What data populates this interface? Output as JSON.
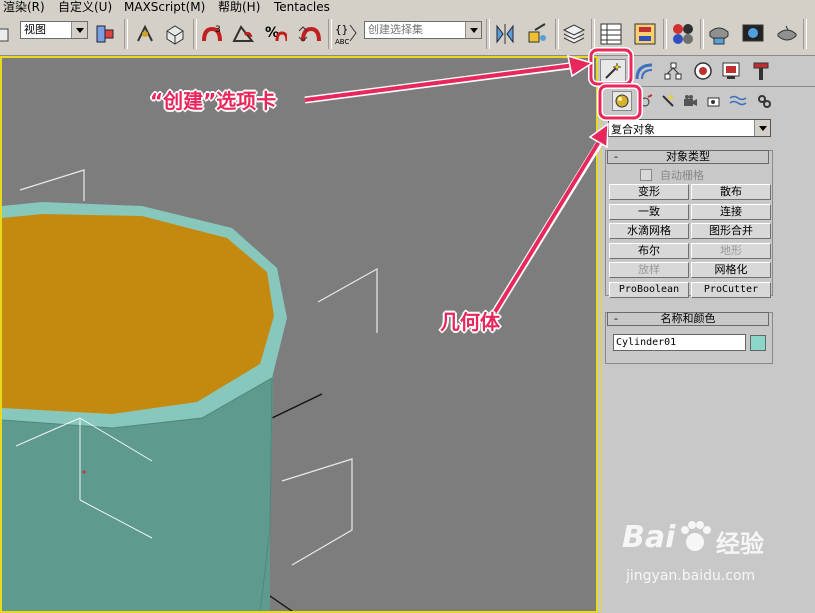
{
  "menu": {
    "items": [
      "渲染(R)",
      "自定义(U)",
      "MAXScript(M)",
      "帮助(H)",
      "Tentacles"
    ]
  },
  "toolbar": {
    "view_combo": "视图",
    "selection_set_placeholder": "创建选择集",
    "abc_label": "ABC"
  },
  "command_panel": {
    "tabs": [
      "create-tab",
      "modify-tab",
      "hierarchy-tab",
      "motion-tab",
      "display-tab",
      "utilities-tab"
    ],
    "category_dropdown": "复合对象",
    "object_type_rollout": {
      "title": "对象类型",
      "collapse_glyph": "-",
      "autogrid_label": "自动栅格",
      "buttons": [
        {
          "label": "变形",
          "enabled": true
        },
        {
          "label": "散布",
          "enabled": true
        },
        {
          "label": "一致",
          "enabled": true
        },
        {
          "label": "连接",
          "enabled": true
        },
        {
          "label": "水滴网格",
          "enabled": true
        },
        {
          "label": "图形合并",
          "enabled": true
        },
        {
          "label": "布尔",
          "enabled": true
        },
        {
          "label": "地形",
          "enabled": false
        },
        {
          "label": "放样",
          "enabled": false
        },
        {
          "label": "网格化",
          "enabled": true
        },
        {
          "label": "ProBoolean",
          "enabled": true
        },
        {
          "label": "ProCutter",
          "enabled": true
        }
      ]
    },
    "name_color_rollout": {
      "title": "名称和颜色",
      "collapse_glyph": "-",
      "object_name": "Cylinder01",
      "swatch_color": "#8ad6c8"
    }
  },
  "annotations": {
    "create_tab": "“创建”选项卡",
    "geometry": "几何体",
    "color": "#e8285c"
  },
  "watermark": {
    "logo_text": "Bai",
    "logo_text2": "经验",
    "url": "jingyan.baidu.com"
  },
  "colors": {
    "viewport_bg": "#7d7d7d",
    "viewport_border": "#e8d820",
    "cylinder_side": "#5f9a8f",
    "cylinder_top": "#c48a10",
    "cylinder_rim": "#88c8bc"
  }
}
